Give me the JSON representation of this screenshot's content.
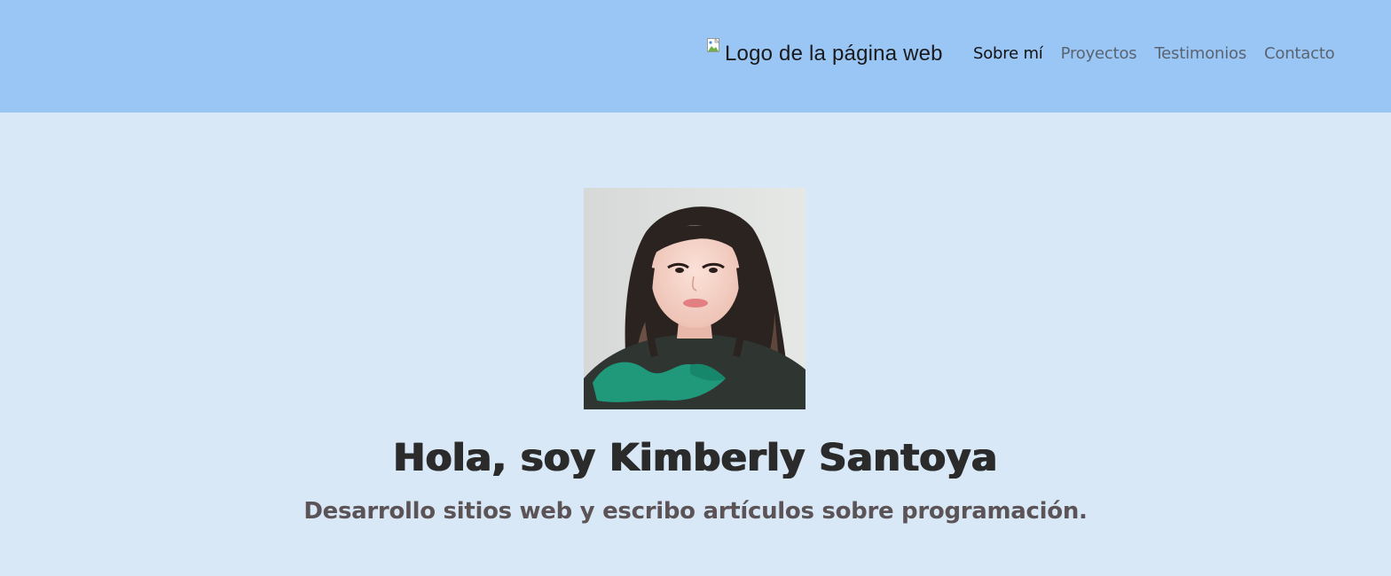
{
  "header": {
    "logo_alt": "Logo de la página web",
    "nav": [
      {
        "label": "Sobre mí",
        "active": true
      },
      {
        "label": "Proyectos",
        "active": false
      },
      {
        "label": "Testimonios",
        "active": false
      },
      {
        "label": "Contacto",
        "active": false
      }
    ]
  },
  "hero": {
    "title": "Hola, soy Kimberly Santoya",
    "subtitle": "Desarrollo sitios web y escribo artículos sobre programación."
  },
  "colors": {
    "header_bg": "#9ac6f6",
    "page_bg": "#d9e8f7",
    "title_text": "#2b2b2b",
    "subtitle_text": "#5b5356"
  }
}
